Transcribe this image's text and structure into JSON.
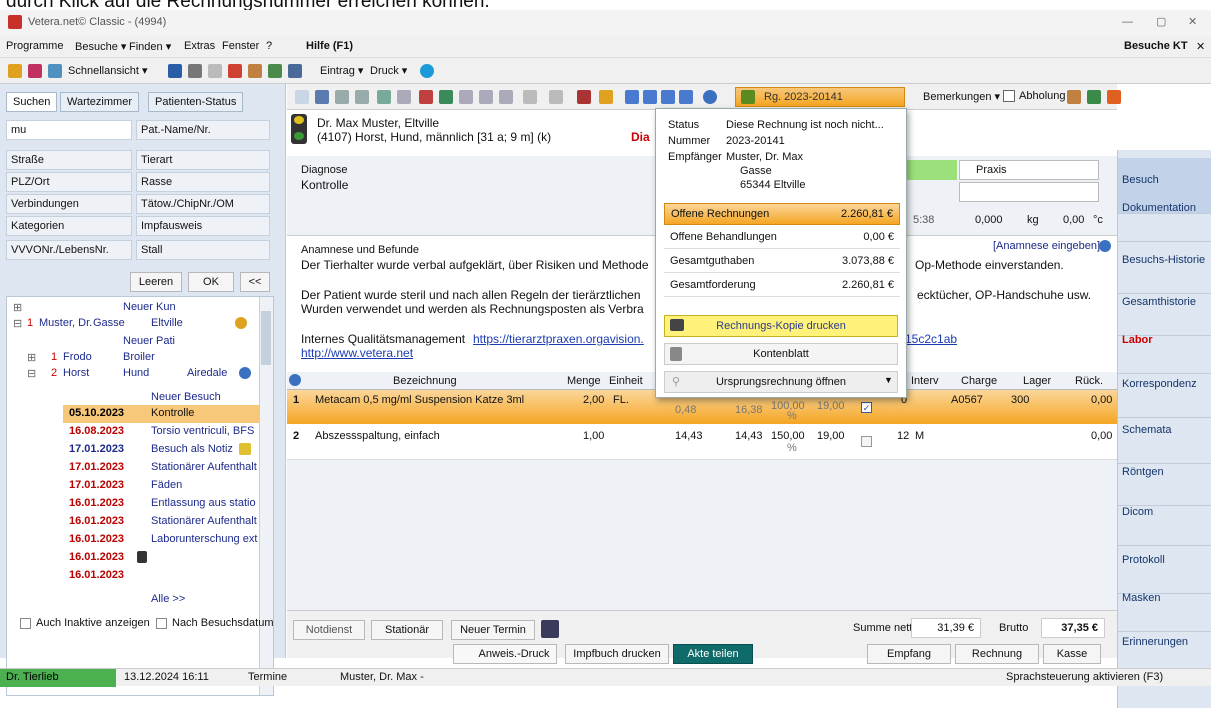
{
  "caption": "durch Klick auf die Rechnungsnummer erreichen können.",
  "window": {
    "title": "Vetera.net© Classic - (4994)",
    "min": "—",
    "max": "▢",
    "close": "✕"
  },
  "menu": {
    "items": [
      "Programme",
      "Besuche ▾",
      "Finden ▾",
      "Extras",
      "Fenster",
      "?",
      "Hilfe (F1)"
    ],
    "right": "Besuche KT",
    "close": "✕"
  },
  "toolbar1": {
    "schnell": "Schnellansicht ▾",
    "eintrag": "Eintrag ▾",
    "druck": "Druck ▾"
  },
  "left": {
    "tabs": [
      "Suchen",
      "Wartezimmer",
      "Patienten-Status"
    ],
    "search_value": "mu",
    "fields": [
      [
        "Pat.-Name/Nr."
      ],
      [
        "Straße",
        "Tierart"
      ],
      [
        "PLZ/Ort",
        "Rasse"
      ],
      [
        "Verbindungen",
        "Tätow./ChipNr./OM"
      ],
      [
        "Kategorien",
        "Impfausweis"
      ],
      [
        "VVVONr./LebensNr.",
        "Stall"
      ]
    ],
    "buttons": {
      "leeren": "Leeren",
      "ok": "OK",
      "more": "<<"
    },
    "tree": {
      "neuer_kun": "Neuer Kun",
      "owner": {
        "num": "1",
        "name": "Muster, Dr.",
        "street": "Gasse",
        "city": "Eltville"
      },
      "neuer_pati": "Neuer Pati",
      "pets": [
        {
          "num": "1",
          "name": "Frodo",
          "breed": "Broiler"
        },
        {
          "num": "2",
          "name": "Horst",
          "species": "Hund",
          "breed": "Airedale"
        }
      ],
      "neuer_besuch": "Neuer Besuch",
      "visits": [
        [
          "05.10.2023",
          "Kontrolle"
        ],
        [
          "16.08.2023",
          "Torsio ventriculi, BFS"
        ],
        [
          "17.01.2023",
          "Besuch als Notiz"
        ],
        [
          "17.01.2023",
          "Stationärer Aufenthalt"
        ],
        [
          "17.01.2023",
          "Fäden"
        ],
        [
          "16.01.2023",
          "Entlassung aus statio"
        ],
        [
          "16.01.2023",
          "Stationärer Aufenthalt"
        ],
        [
          "16.01.2023",
          "Laborunterschung ext"
        ],
        [
          "16.01.2023",
          ""
        ],
        [
          "16.01.2023",
          ""
        ]
      ],
      "alle": "Alle >>"
    },
    "checks": [
      "Auch Inaktive anzeigen",
      "Nach Besuchsdatum"
    ]
  },
  "main": {
    "patient_name": "Dr. Max Muster, Eltville",
    "patient_info": "(4107) Horst, Hund, männlich [31 a; 9 m] (k)",
    "dia": "Dia",
    "rg_button": "Rg. 2023-20141",
    "bemerkungen": "Bemerkungen ▾",
    "abholung": "Abholung",
    "diagnose_label": "Diagnose",
    "diagnose": "Kontrolle",
    "praxis": "Praxis",
    "time": "5:38",
    "weight": "0,000",
    "unit_kg": "kg",
    "temp": "0,00",
    "unit_c": "°c",
    "anamnese_label": "Anamnese und Befunde",
    "anamnese_btn": "[Anamnese eingeben]",
    "text_lines": [
      "Der Tierhalter wurde verbal aufgeklärt, über Risiken und Methode",
      "Der Patient wurde steril und nach allen Regeln der tierärztlichen",
      "Wurden verwendet und werden als Rechnungsposten als Verbra",
      "Internes Qualitätsmanagement",
      "http://www.vetera.net"
    ],
    "text_right": [
      "Op-Methode einverstanden.",
      "ecktücher, OP-Handschuhe usw.",
      "15c2c1ab"
    ],
    "link": "https://tierarztpraxen.orgavision.",
    "table": {
      "headers": [
        "Bezeichnung",
        "Menge",
        "Einheit",
        "",
        "",
        "",
        "",
        "",
        "Interv",
        "Charge",
        "Lager",
        "Rück."
      ],
      "rows": [
        {
          "n": "1",
          "bez": "Metacam 0,5 mg/ml Suspension Katze 3ml",
          "menge": "2,00",
          "einheit": "FL.",
          "a": "0,48",
          "b": "16,38",
          "c": "100,00",
          "pct": "%",
          "d": "19,00",
          "interv": "0",
          "charge": "A0567",
          "lager": "300",
          "rueck": "0,00"
        },
        {
          "n": "2",
          "bez": "Abszessspaltung, einfach",
          "menge": "1,00",
          "einheit": "",
          "a": "14,43",
          "b": "14,43",
          "c": "150,00",
          "pct": "%",
          "d": "19,00",
          "interv": "12",
          "unit": "M",
          "charge": "",
          "lager": "",
          "rueck": "0,00"
        }
      ]
    },
    "footer": {
      "notdienst": "Notdienst",
      "stationaer": "Stationär",
      "neuer_termin": "Neuer Termin",
      "summe_label": "Summe netto",
      "summe": "31,39 €",
      "brutto_label": "Brutto",
      "brutto": "37,35 €",
      "anweis": "Anweis.-Druck",
      "impfbuch": "Impfbuch drucken",
      "akte": "Akte teilen",
      "empfang": "Empfang",
      "rechnung": "Rechnung",
      "kasse": "Kasse"
    }
  },
  "popup": {
    "status_label": "Status",
    "status": "Diese Rechnung ist noch nicht...",
    "nummer_label": "Nummer",
    "nummer": "2023-20141",
    "empf_label": "Empfänger",
    "empf1": "Muster, Dr. Max",
    "empf2": "Gasse",
    "empf3": "65344 Eltville",
    "lines": [
      [
        "Offene Rechnungen",
        "2.260,81 €"
      ],
      [
        "Offene Behandlungen",
        "0,00 €"
      ],
      [
        "Gesamtguthaben",
        "3.073,88 €"
      ],
      [
        "Gesamtforderung",
        "2.260,81 €"
      ]
    ],
    "kopie": "Rechnungs-Kopie drucken",
    "konto": "Kontenblatt",
    "ursprung": "Ursprungsrechnung öffnen"
  },
  "nav": [
    "Besuch",
    "Dokumentation",
    "Besuchs-Historie",
    "Gesamthistorie",
    "Labor",
    "Korrespondenz",
    "Schemata",
    "Röntgen",
    "Dicom",
    "Protokoll",
    "Masken",
    "Erinnerungen"
  ],
  "status": {
    "user": "Dr. Tierlieb",
    "datetime": "13.12.2024  16:11",
    "termine": "Termine",
    "patient": "Muster, Dr. Max -",
    "sprach": "Sprachsteuerung aktivieren (F3)"
  },
  "colors": {
    "accent": "#f5a623",
    "nav_bg": "#dde6f1",
    "row_sel": "#f7b85a",
    "teal": "#0f6a6a"
  }
}
